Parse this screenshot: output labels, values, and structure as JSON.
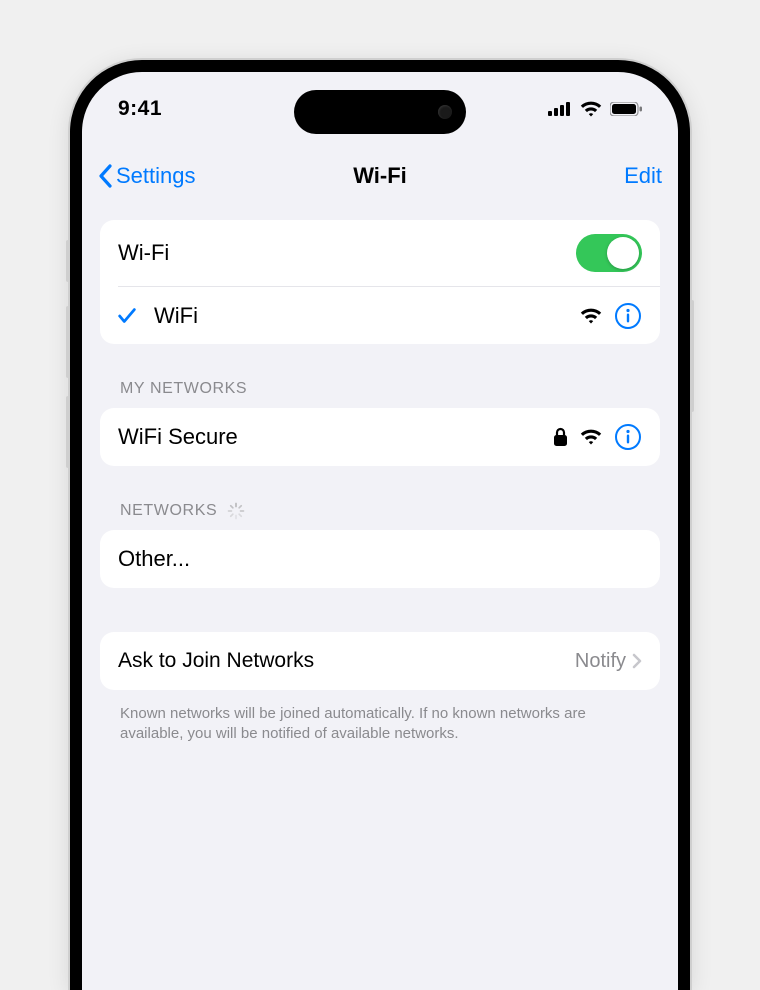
{
  "status": {
    "time": "9:41"
  },
  "nav": {
    "back": "Settings",
    "title": "Wi-Fi",
    "edit": "Edit"
  },
  "wifi": {
    "toggle_label": "Wi-Fi",
    "toggle_on": true,
    "connected_name": "WiFi"
  },
  "sections": {
    "my_networks_header": "MY NETWORKS",
    "my_networks": [
      {
        "name": "WiFi Secure",
        "locked": true
      }
    ],
    "networks_header": "NETWORKS",
    "other_label": "Other..."
  },
  "ask": {
    "label": "Ask to Join Networks",
    "value": "Notify",
    "footnote": "Known networks will be joined automatically. If no known networks are available, you will be notified of available networks."
  }
}
